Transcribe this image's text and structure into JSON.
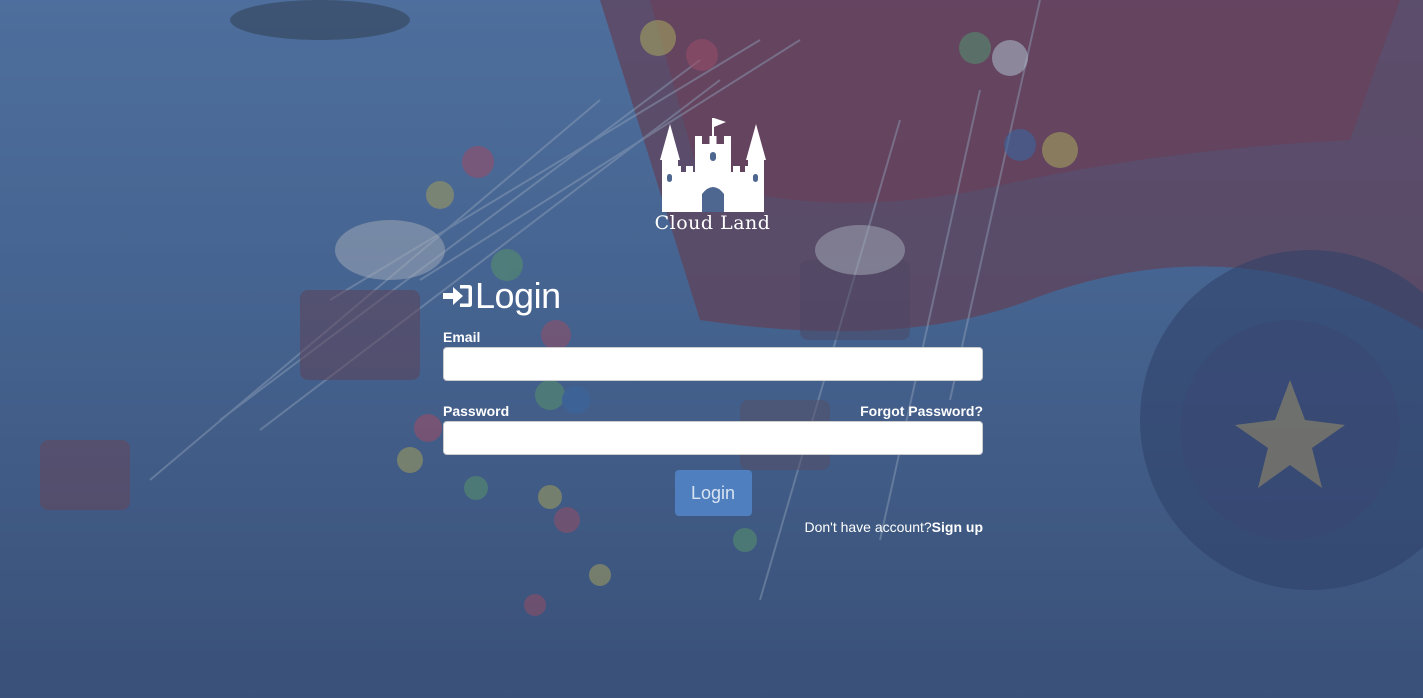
{
  "brand": {
    "name": "Cloud Land"
  },
  "login": {
    "heading": "Login",
    "email_label": "Email",
    "email_value": "",
    "password_label": "Password",
    "password_value": "",
    "forgot_link": "Forgot Password?",
    "submit_label": "Login",
    "signup_prompt": "Don't have account?",
    "signup_link": "Sign up"
  },
  "icons": {
    "logo": "castle-icon",
    "heading": "sign-in-icon"
  },
  "colors": {
    "overlay": "#3b5680",
    "button": "#4f7fbf",
    "text": "#ffffff"
  }
}
